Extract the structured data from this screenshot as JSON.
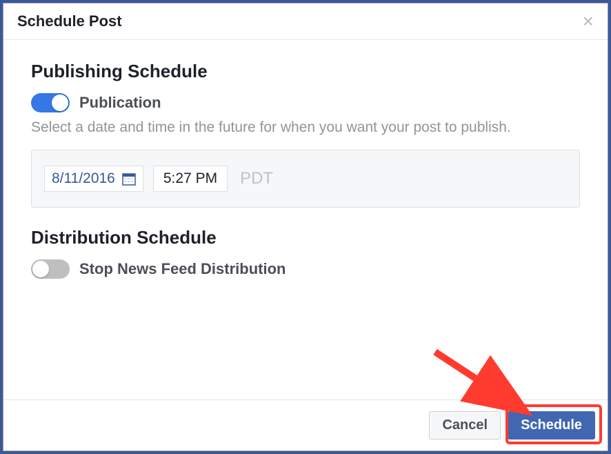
{
  "modal": {
    "title": "Schedule Post"
  },
  "publishing": {
    "heading": "Publishing Schedule",
    "toggle_label": "Publication",
    "description": "Select a date and time in the future for when you want your post to publish.",
    "date": "8/11/2016",
    "time": "5:27 PM",
    "timezone": "PDT"
  },
  "distribution": {
    "heading": "Distribution Schedule",
    "toggle_label": "Stop News Feed Distribution"
  },
  "footer": {
    "cancel": "Cancel",
    "schedule": "Schedule"
  }
}
